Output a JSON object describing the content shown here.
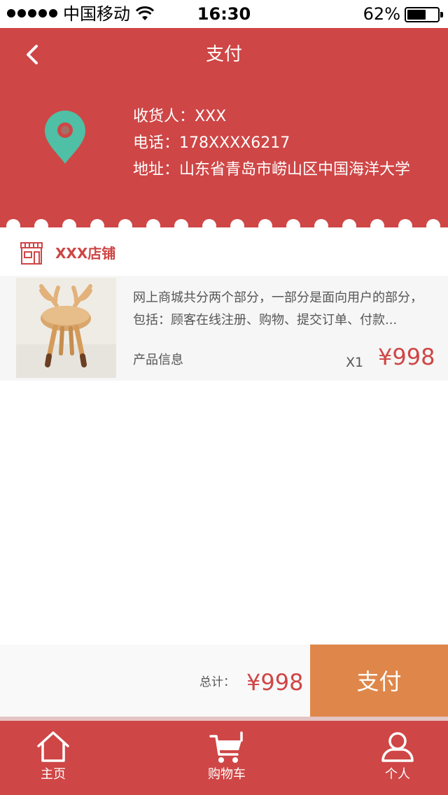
{
  "status_bar": {
    "carrier": "中国移动",
    "time": "16:30",
    "battery": "62%",
    "battery_level": 0.62
  },
  "header": {
    "title": "支付",
    "consignee": "收货人：XXX",
    "phone": "电话：178XXXX6217",
    "address": "地址：山东省青岛市崂山区中国海洋大学"
  },
  "store": {
    "name": "XXX店铺"
  },
  "product": {
    "description": "网上商城共分两个部分，一部分是面向用户的部分，包括：顾客在线注册、购物、提交订单、付款...",
    "label": "产品信息",
    "quantity": "X1",
    "price": "¥998"
  },
  "pay_bar": {
    "total_label": "总计：",
    "total_value": "¥998",
    "pay_label": "支付"
  },
  "tab_bar": {
    "items": [
      {
        "label": "主页",
        "icon": "home-icon"
      },
      {
        "label": "购物车",
        "icon": "cart-icon"
      },
      {
        "label": "个人",
        "icon": "user-icon"
      }
    ]
  },
  "colors": {
    "brand_red": "#cf4646",
    "pin_teal": "#4fbfa5",
    "pay_orange": "#df874a"
  }
}
